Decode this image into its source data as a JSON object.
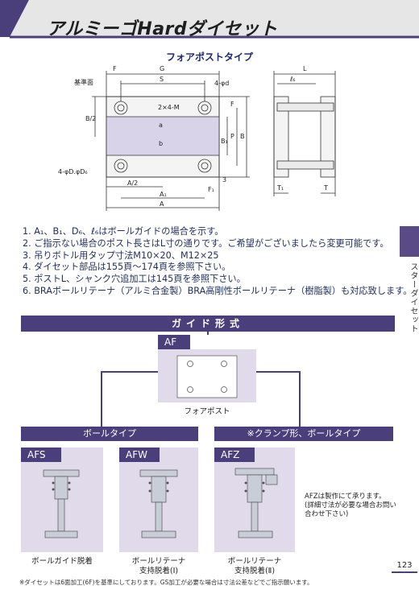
{
  "page": {
    "title": "アルミーゴHardダイセット",
    "subtitle": "フォアポストタイプ",
    "side_label": "スターダイセット",
    "page_number": "123",
    "footnote": "※ダイセットは6面加工(6F)を基準にしております。GS加工が必要な場合は寸法公差などでご指示願います。"
  },
  "drawing_labels": {
    "F": "F",
    "G": "G",
    "S": "S",
    "L": "L",
    "l6": "ℓ₆",
    "datum": "基準面",
    "b2": "B/2",
    "hole4d": "4-φd",
    "tap": "2×4-M",
    "a": "a",
    "b": "b",
    "B1": "B₁",
    "P": "P",
    "B": "B",
    "postdia": "4-φD.φD₆",
    "A2": "A/2",
    "A1": "A₁",
    "A": "A",
    "F1": "F₁",
    "three": "3",
    "T1": "T₁",
    "T": "T"
  },
  "notes": [
    "1.  A₁、B₁、D₆、ℓ₆はボールガイドの場合を示す。",
    "2.  ご指示ない場合のポスト長さはL寸の通りです。ご希望がございましたら変更可能です。",
    "3.  吊りボトル用タップ寸法M10×20、M12×25",
    "4.  ダイセット部品は155頁～174頁を参照下さい。",
    "5.  ポストL、シャンク穴追加工は145頁を参照下さい。",
    "6.  BRAボールリテーナ（アルミ合金製）BRA高剛性ボールリテーナ（樹脂製）も対応致します。"
  ],
  "guide": {
    "band_title": "ガイド形式",
    "af": {
      "label": "AF",
      "caption": "フォアポスト"
    },
    "left_group": "ボールタイプ",
    "right_group": "※クランプ形、ボールタイプ",
    "items": [
      {
        "label": "AFS",
        "caption": "ボールガイド脱着"
      },
      {
        "label": "AFW",
        "caption": "ボールリテーナ\n支持脱着(Ⅰ)"
      },
      {
        "label": "AFZ",
        "caption": "ボールリテーナ\n支持脱着(Ⅱ)"
      }
    ],
    "afz_note": "AFZは製作にて承ります。\n(詳細寸法が必要な場合お問い\n合わせ下さい)"
  },
  "colors": {
    "accent": "#4b3f7b",
    "lavender": "#e1daea",
    "steel": "#c8cdd8"
  }
}
